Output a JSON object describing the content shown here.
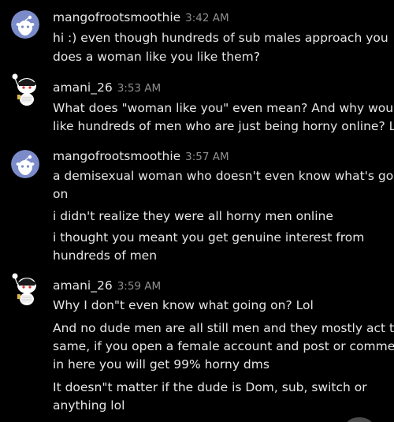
{
  "messages": [
    {
      "username": "mangofrootsmoothie",
      "time": "3:42 AM",
      "avatar": "reddit-snoo-avatar-blue",
      "lines": [
        "hi :) even though hundreds of sub males approach you",
        "does a woman like you like them?"
      ]
    },
    {
      "username": "amani_26",
      "time": "3:53 AM",
      "avatar": "reddit-snoo-avatar-custom",
      "lines": [
        "What does \"woman like you\" even mean? And why would I",
        "like hundreds of men who are just being horny online? Lol"
      ]
    },
    {
      "username": "mangofrootsmoothie",
      "time": "3:57 AM",
      "avatar": "reddit-snoo-avatar-blue",
      "lines": [
        "a demisexual woman who doesn't even know what's going",
        "on",
        "i didn't realize they were all horny men online",
        "i thought you meant you get genuine interest from",
        "hundreds of men"
      ]
    },
    {
      "username": "amani_26",
      "time": "3:59 AM",
      "avatar": "reddit-snoo-avatar-custom",
      "lines": [
        "Why I don\"t even know what going on? Lol",
        "And no dude men are all still men and they mostly act the",
        "same, if you open a female account and post or comment",
        "in here you will get 99% horny dms",
        "It doesn\"t matter if the dude is Dom, sub, switch or",
        "anything lol"
      ]
    }
  ],
  "colors": {
    "background": "#000000",
    "text": "#e6e6e6",
    "timestamp": "#8f8f8f",
    "avatar_blue": "#7a8cc9"
  }
}
